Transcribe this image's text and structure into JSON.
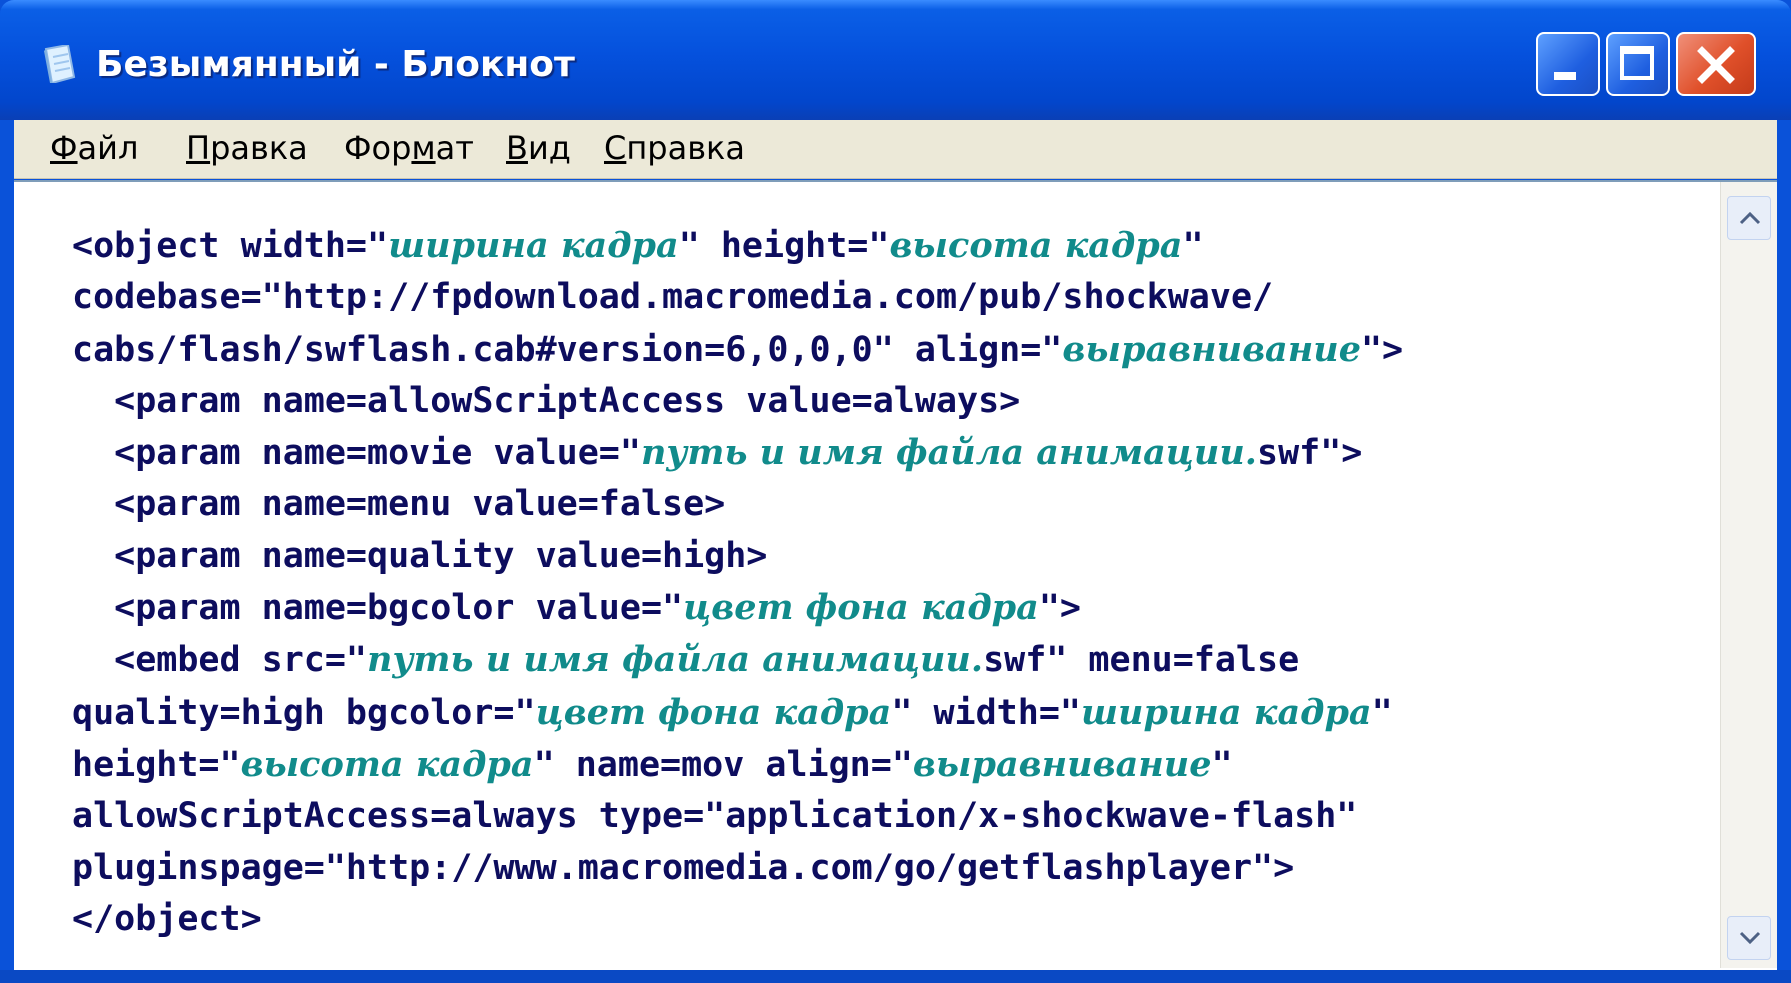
{
  "window": {
    "title": "Безымянный - Блокнот",
    "app_icon": "notepad-icon",
    "controls": {
      "minimize_icon": "minimize-icon",
      "maximize_icon": "maximize-icon",
      "close_icon": "close-icon"
    }
  },
  "menu": {
    "items": [
      {
        "label_first": "Ф",
        "label_rest": "айл",
        "full": "Файл"
      },
      {
        "label_first": "П",
        "label_rest": "равка",
        "full": "Правка"
      },
      {
        "label_pre": "Фор",
        "label_first": "м",
        "label_rest": "ат",
        "full": "Формат"
      },
      {
        "label_first": "В",
        "label_rest": "ид",
        "full": "Вид"
      },
      {
        "label_first": "С",
        "label_rest": "правка",
        "full": "Справка"
      }
    ]
  },
  "editor": {
    "lines": [
      {
        "parts": [
          {
            "t": "<object width=\""
          },
          {
            "t": "ширина кадра",
            "ph": true
          },
          {
            "t": "\" height=\""
          },
          {
            "t": "высота кадра",
            "ph": true
          },
          {
            "t": "\""
          }
        ]
      },
      {
        "parts": [
          {
            "t": "codebase=\"http://fpdownload.macromedia.com/pub/shockwave/"
          }
        ]
      },
      {
        "parts": [
          {
            "t": "cabs/flash/swflash.cab#version=6,0,0,0\" align=\""
          },
          {
            "t": "выравнивание",
            "ph": true
          },
          {
            "t": "\">"
          }
        ]
      },
      {
        "parts": [
          {
            "t": "  <param name=allowScriptAccess value=always>"
          }
        ]
      },
      {
        "parts": [
          {
            "t": "  <param name=movie value=\""
          },
          {
            "t": "путь и имя файла анимации.",
            "ph": true
          },
          {
            "t": "swf\">"
          }
        ]
      },
      {
        "parts": [
          {
            "t": "  <param name=menu value=false>"
          }
        ]
      },
      {
        "parts": [
          {
            "t": "  <param name=quality value=high>"
          }
        ]
      },
      {
        "parts": [
          {
            "t": "  <param name=bgcolor value=\""
          },
          {
            "t": "цвет фона кадра",
            "ph": true
          },
          {
            "t": "\">"
          }
        ]
      },
      {
        "parts": [
          {
            "t": "  <embed src=\""
          },
          {
            "t": "путь и имя файла анимации.",
            "ph": true
          },
          {
            "t": "swf\" menu=false"
          }
        ]
      },
      {
        "parts": [
          {
            "t": "quality=high bgcolor=\""
          },
          {
            "t": "цвет фона кадра",
            "ph": true
          },
          {
            "t": "\" width=\""
          },
          {
            "t": "ширина кадра",
            "ph": true
          },
          {
            "t": "\""
          }
        ]
      },
      {
        "parts": [
          {
            "t": "height=\""
          },
          {
            "t": "высота кадра",
            "ph": true
          },
          {
            "t": "\" name=mov align=\""
          },
          {
            "t": "выравнивание",
            "ph": true
          },
          {
            "t": "\""
          }
        ]
      },
      {
        "parts": [
          {
            "t": "allowScriptAccess=always type=\"application/x-shockwave-flash\""
          }
        ]
      },
      {
        "parts": [
          {
            "t": "pluginspage=\"http://www.macromedia.com/go/getflashplayer\">"
          }
        ]
      },
      {
        "parts": [
          {
            "t": "</object>"
          }
        ]
      }
    ],
    "scroll_up_icon": "scroll-up-arrow-icon",
    "scroll_down_icon": "scroll-down-arrow-icon"
  },
  "colors": {
    "titlebar": "#0551dd",
    "menubar": "#ece9d8",
    "code_text": "#0d0d5e",
    "placeholder_text": "#118b8b",
    "close_button": "#e0502a"
  }
}
